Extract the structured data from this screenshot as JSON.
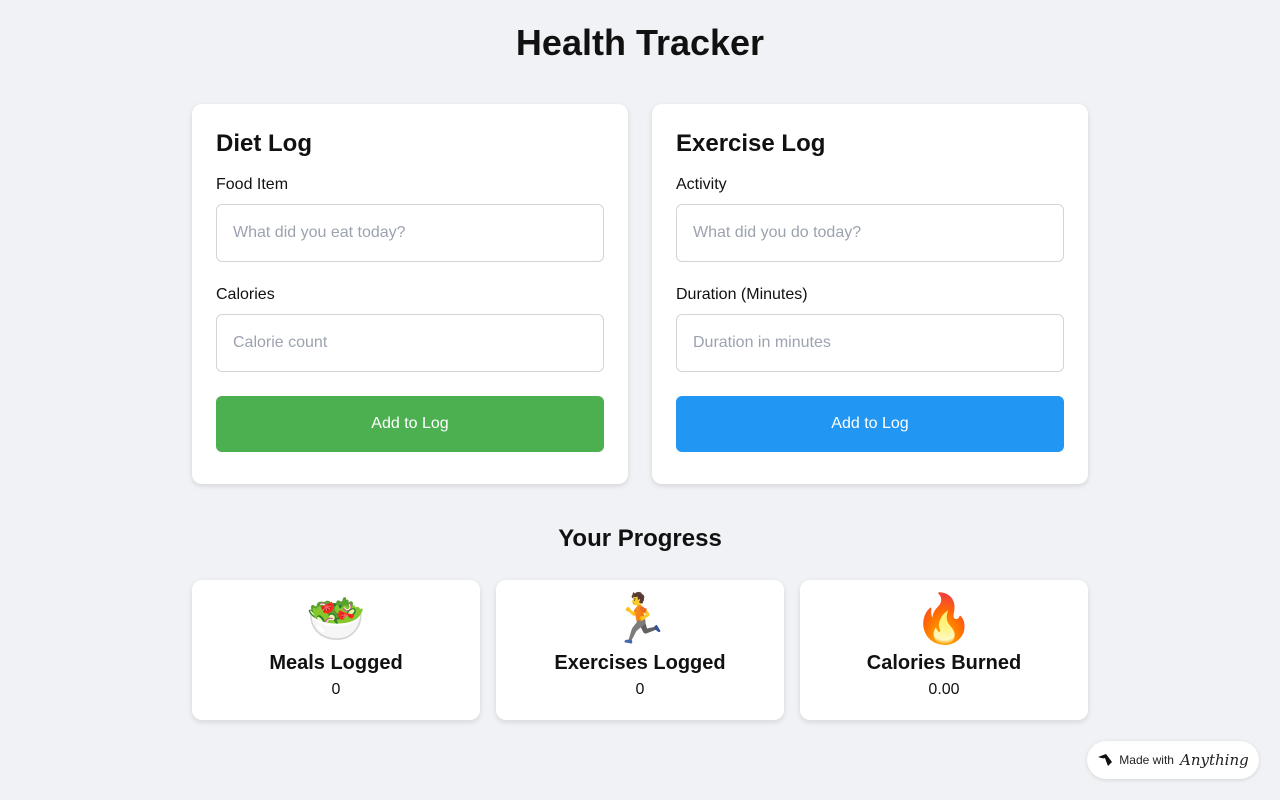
{
  "app": {
    "title": "Health Tracker"
  },
  "diet": {
    "title": "Diet Log",
    "food_label": "Food Item",
    "food_placeholder": "What did you eat today?",
    "food_value": "",
    "calories_label": "Calories",
    "calories_placeholder": "Calorie count",
    "calories_value": "",
    "button_label": "Add to Log",
    "button_color": "#4caf50"
  },
  "exercise": {
    "title": "Exercise Log",
    "activity_label": "Activity",
    "activity_placeholder": "What did you do today?",
    "activity_value": "",
    "duration_label": "Duration (Minutes)",
    "duration_placeholder": "Duration in minutes",
    "duration_value": "",
    "button_label": "Add to Log",
    "button_color": "#2196f3"
  },
  "progress": {
    "title": "Your Progress",
    "stats": [
      {
        "icon": "salad-icon",
        "glyph": "🥗",
        "label": "Meals Logged",
        "value": "0"
      },
      {
        "icon": "runner-icon",
        "glyph": "🏃",
        "label": "Exercises Logged",
        "value": "0"
      },
      {
        "icon": "fire-icon",
        "glyph": "🔥",
        "label": "Calories Burned",
        "value": "0.00"
      }
    ]
  },
  "badge": {
    "prefix": "Made with",
    "brand": "Anything",
    "icon": "anything-logo-icon"
  }
}
